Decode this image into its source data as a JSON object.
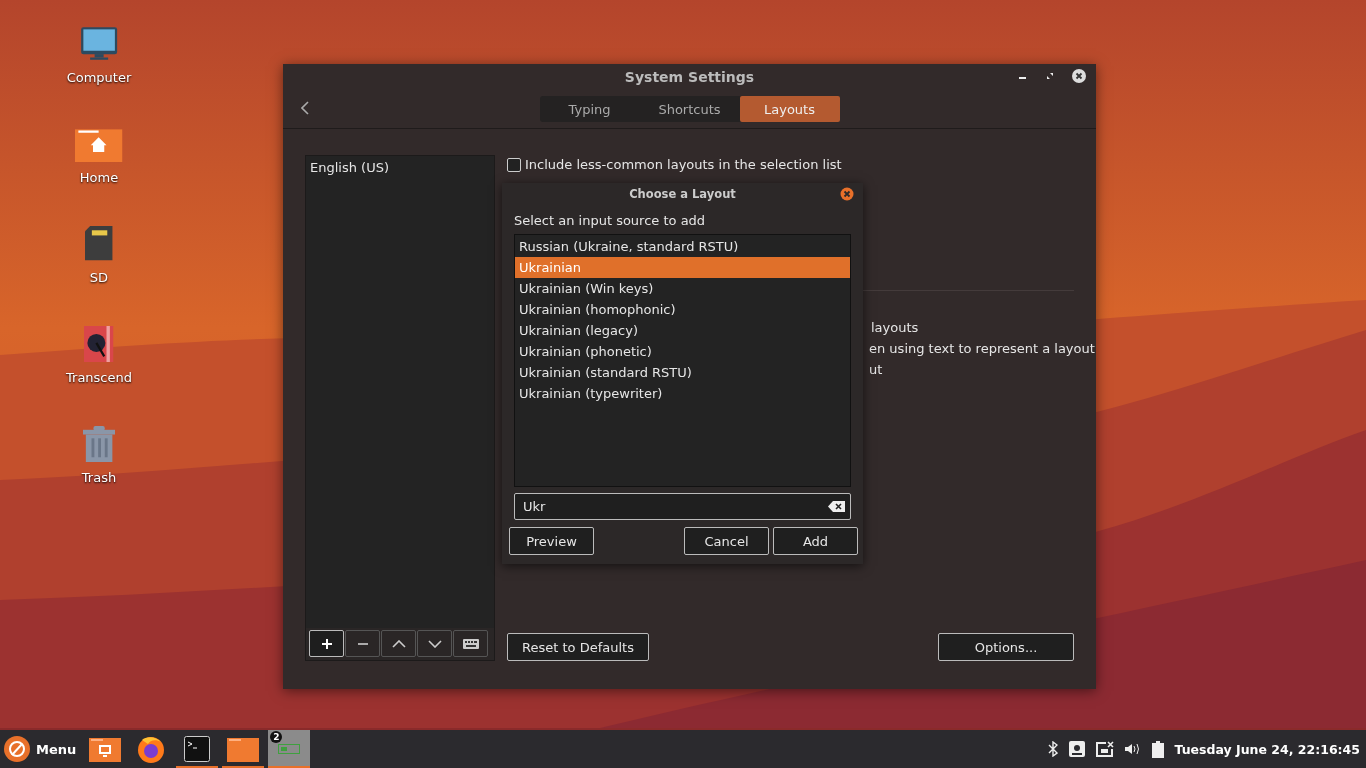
{
  "desktop_icons": [
    {
      "label": "Computer",
      "kind": "monitor"
    },
    {
      "label": "Home",
      "kind": "home"
    },
    {
      "label": "SD",
      "kind": "sdcard"
    },
    {
      "label": "Transcend",
      "kind": "drive"
    },
    {
      "label": "Trash",
      "kind": "trash"
    }
  ],
  "window": {
    "title": "System Settings",
    "tabs": [
      {
        "label": "Typing",
        "selected": false
      },
      {
        "label": "Shortcuts",
        "selected": false
      },
      {
        "label": "Layouts",
        "selected": true
      }
    ],
    "layouts": [
      {
        "label": "English (US)",
        "selected": false
      }
    ],
    "less_common": {
      "label": "Include less-common layouts in the selection list",
      "checked": false
    },
    "obscured_texts": [
      "layouts",
      "en using text to represent a layout",
      "ut"
    ],
    "reset_button": "Reset to Defaults",
    "options_button": "Options..."
  },
  "dialog": {
    "title": "Choose a Layout",
    "prompt": "Select an input source to add",
    "items": [
      {
        "label": "Russian (Ukraine, standard RSTU)",
        "selected": false
      },
      {
        "label": "Ukrainian",
        "selected": true
      },
      {
        "label": "Ukrainian (Win keys)",
        "selected": false
      },
      {
        "label": "Ukrainian (homophonic)",
        "selected": false
      },
      {
        "label": "Ukrainian (legacy)",
        "selected": false
      },
      {
        "label": "Ukrainian (phonetic)",
        "selected": false
      },
      {
        "label": "Ukrainian (standard RSTU)",
        "selected": false
      },
      {
        "label": "Ukrainian (typewriter)",
        "selected": false
      }
    ],
    "search": {
      "value": "Ukr"
    },
    "preview_button": "Preview",
    "cancel_button": "Cancel",
    "add_button": "Add"
  },
  "taskbar": {
    "menu_label": "Menu",
    "apps": [
      {
        "kind": "remote-folder",
        "running": false
      },
      {
        "kind": "browser",
        "running": false
      },
      {
        "kind": "terminal",
        "running": true
      },
      {
        "kind": "folder",
        "running": true
      },
      {
        "kind": "workspace",
        "running": true,
        "badge": "2"
      }
    ],
    "clock": "Tuesday June 24, 22:16:45"
  }
}
